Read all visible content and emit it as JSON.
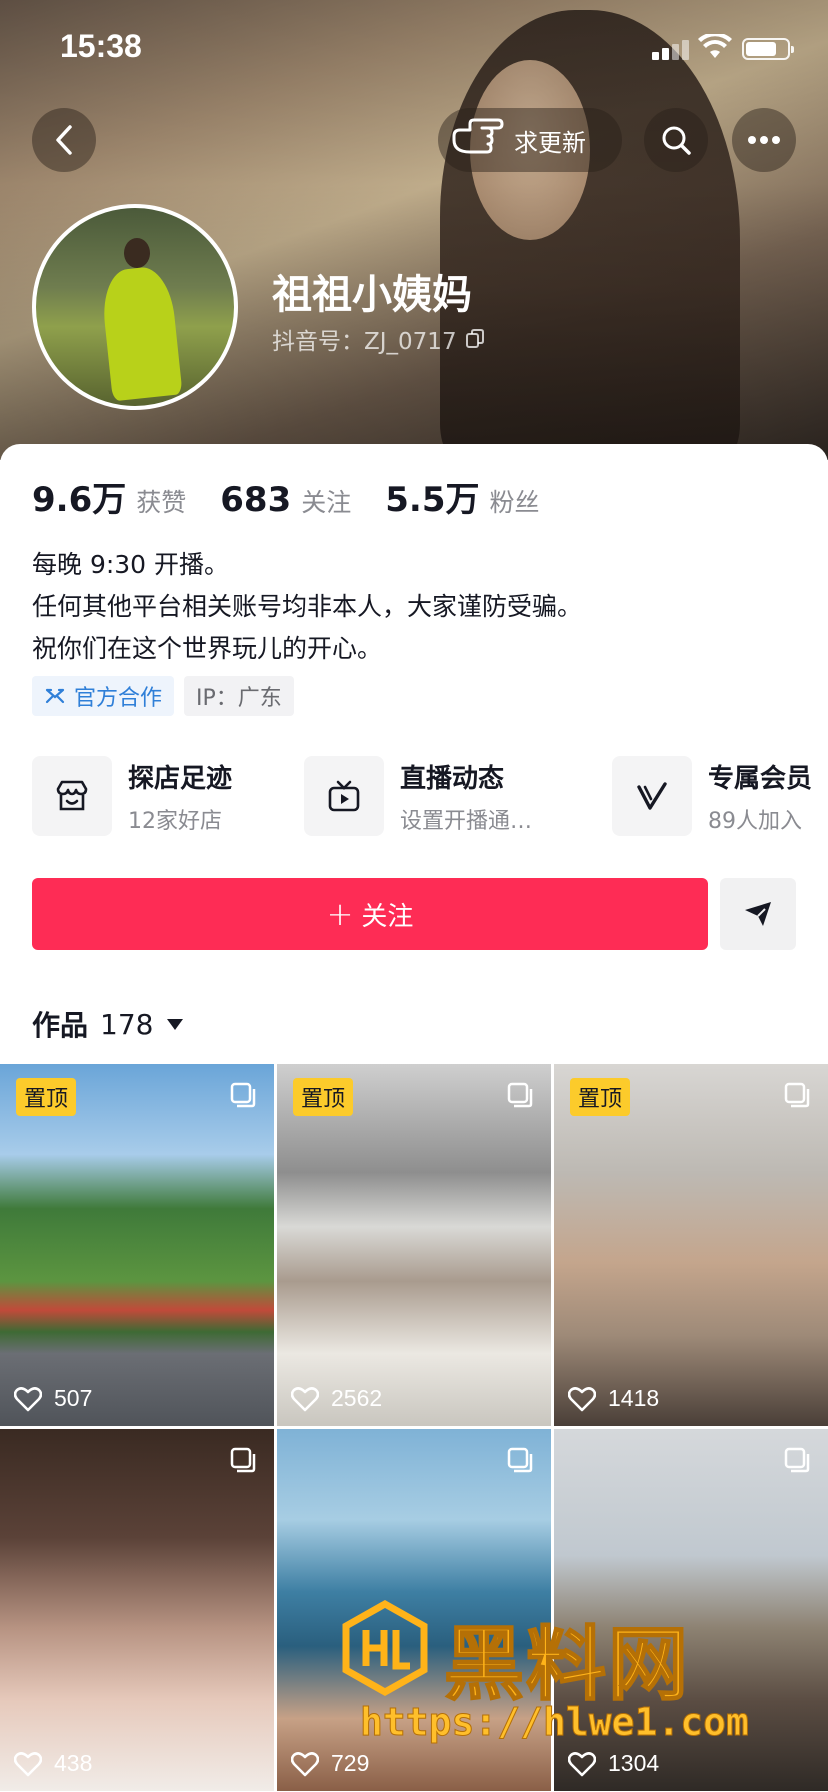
{
  "status_bar": {
    "time": "15:38",
    "battery_level": 0.75
  },
  "header": {
    "update_label": "求更新",
    "nickname": "祖祖小姨妈",
    "douyin_id": "抖音号：ZJ_0717"
  },
  "stats": [
    {
      "value": "9.6万",
      "label": "获赞"
    },
    {
      "value": "683",
      "label": "关注"
    },
    {
      "value": "5.5万",
      "label": "粉丝"
    }
  ],
  "bio": [
    "每晚 9:30 开播。",
    "任何其他平台相关账号均非本人，大家谨防受骗。",
    "祝你们在这个世界玩儿的开心。"
  ],
  "tags": {
    "official": "官方合作",
    "ip": "IP：广东"
  },
  "features": [
    {
      "title": "探店足迹",
      "sub": "12家好店",
      "icon": "store-icon"
    },
    {
      "title": "直播动态",
      "sub": "设置开播通…",
      "icon": "tv-icon"
    },
    {
      "title": "专属会员",
      "sub": "89人加入",
      "icon": "vip-icon"
    }
  ],
  "actions": {
    "follow_label": "关注",
    "follow_plus": "+"
  },
  "works": {
    "label": "作品",
    "count": "178"
  },
  "videos": [
    {
      "pinned": "置顶",
      "likes": "507"
    },
    {
      "pinned": "置顶",
      "likes": "2562"
    },
    {
      "pinned": "置顶",
      "likes": "1418"
    },
    {
      "pinned": "",
      "likes": "438"
    },
    {
      "pinned": "",
      "likes": "729"
    },
    {
      "pinned": "",
      "likes": "1304"
    }
  ],
  "watermark": {
    "brand": "黑料网",
    "url": "https://hlwe1.com"
  },
  "colors": {
    "accent": "#fe2c55",
    "pin": "#fccb2b",
    "official": "#2f7fd8"
  }
}
